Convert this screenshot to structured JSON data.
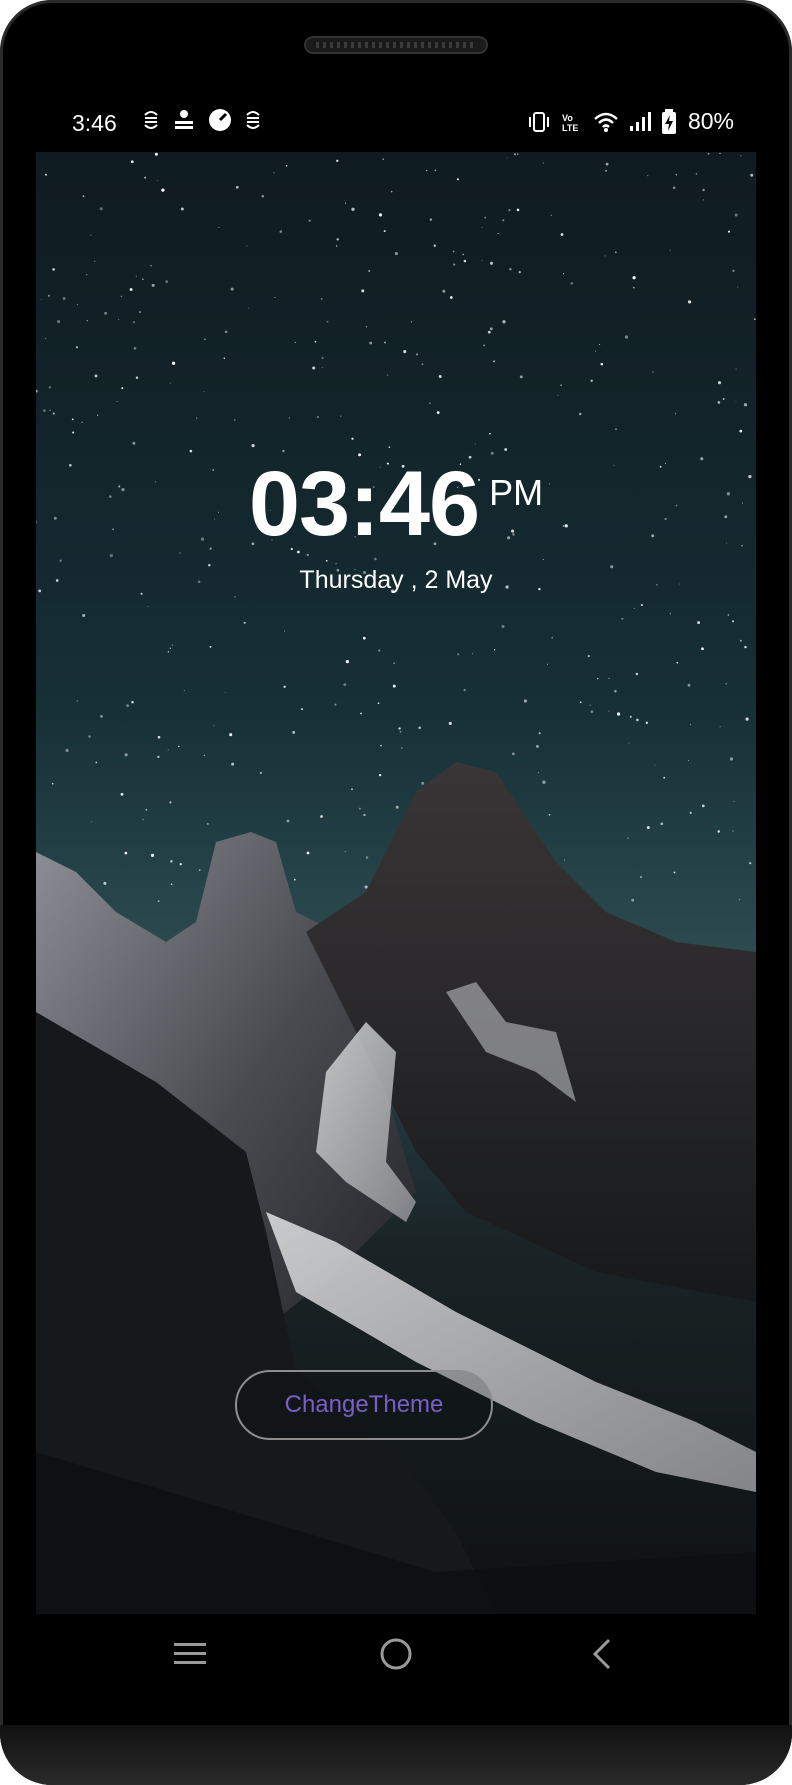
{
  "status_bar": {
    "time": "3:46",
    "battery_percent": "80%",
    "left_icons": [
      "sync-icon",
      "notification-icon",
      "speed-icon",
      "sync-icon"
    ],
    "right_icons": [
      "vibrate-icon",
      "volte-icon",
      "wifi-icon",
      "signal-icon",
      "battery-charging-icon"
    ]
  },
  "clock": {
    "time": "03:46",
    "ampm": "PM",
    "date": "Thursday , 2 May"
  },
  "theme_button": {
    "label": "ChangeTheme"
  },
  "nav_bar": {
    "items": [
      "recents-icon",
      "home-icon",
      "back-icon"
    ]
  },
  "colors": {
    "accent": "#7a5fc7",
    "status_text": "#ffffff"
  }
}
